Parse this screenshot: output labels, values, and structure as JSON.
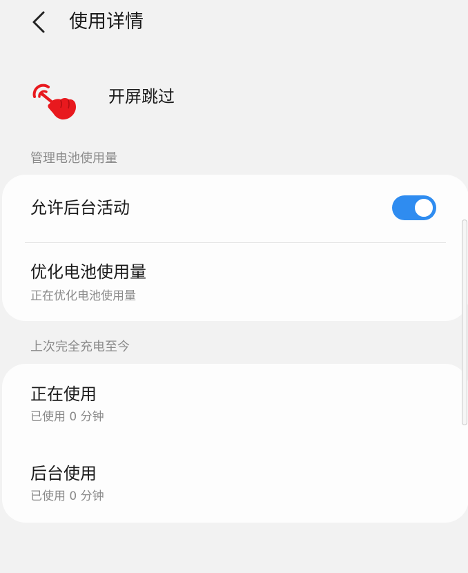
{
  "header": {
    "title": "使用详情"
  },
  "app": {
    "name": "开屏跳过",
    "icon": "tap-hand-icon"
  },
  "sections": {
    "battery_management": {
      "header": "管理电池使用量",
      "allow_background": {
        "title": "允许后台活动",
        "enabled": true
      },
      "optimize": {
        "title": "优化电池使用量",
        "subtitle": "正在优化电池使用量"
      }
    },
    "since_full_charge": {
      "header": "上次完全充电至今",
      "foreground": {
        "title": "正在使用",
        "subtitle": "已使用 0 分钟"
      },
      "background": {
        "title": "后台使用",
        "subtitle": "已使用 0 分钟"
      }
    }
  },
  "colors": {
    "accent": "#2f8cf0",
    "icon_red": "#e8191e",
    "background": "#f2f2f2",
    "card": "#fdfdfd"
  }
}
